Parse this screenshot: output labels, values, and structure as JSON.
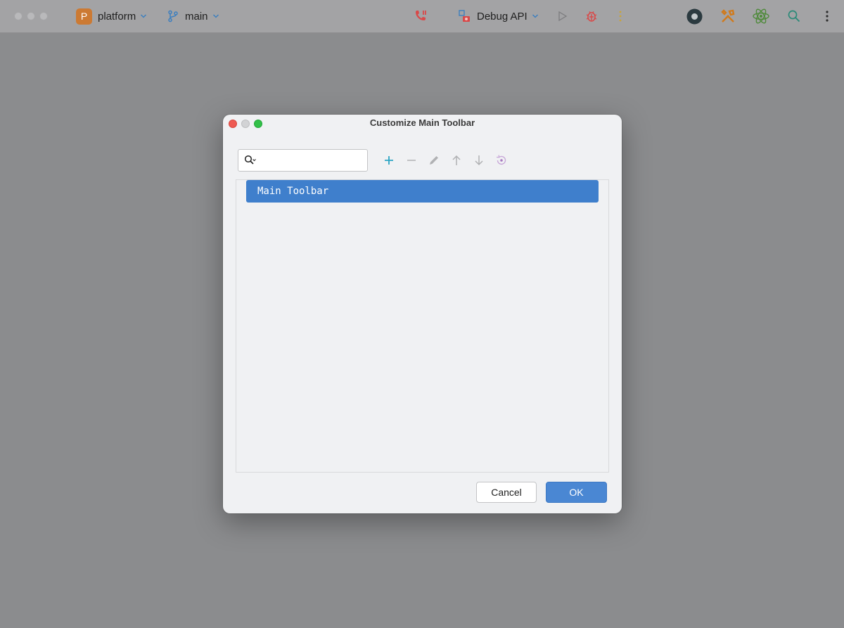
{
  "titlebar": {
    "project": {
      "badge": "P",
      "name": "platform"
    },
    "branch": {
      "name": "main"
    },
    "run_config": {
      "name": "Debug API"
    },
    "icons": [
      "call-icon",
      "run-config-icon",
      "run-icon",
      "debug-icon",
      "more-vertical-icon",
      "record-icon",
      "build-tools-icon",
      "react-icon",
      "search-icon",
      "kebab-menu-icon"
    ]
  },
  "dialog": {
    "title": "Customize Main Toolbar",
    "search": {
      "value": "",
      "placeholder": ""
    },
    "actions": [
      "add-icon",
      "remove-icon",
      "edit-icon",
      "move-up-icon",
      "move-down-icon",
      "restore-icon"
    ],
    "tree": {
      "items": [
        {
          "label": "Main Toolbar",
          "selected": true
        }
      ]
    },
    "buttons": {
      "cancel": "Cancel",
      "ok": "OK"
    }
  },
  "colors": {
    "accent": "#3f7fcc",
    "ok_button": "#4a87d3",
    "project_badge": "#cc7a33",
    "add_icon": "#2aa4c3",
    "debug_icon": "#d94949"
  }
}
